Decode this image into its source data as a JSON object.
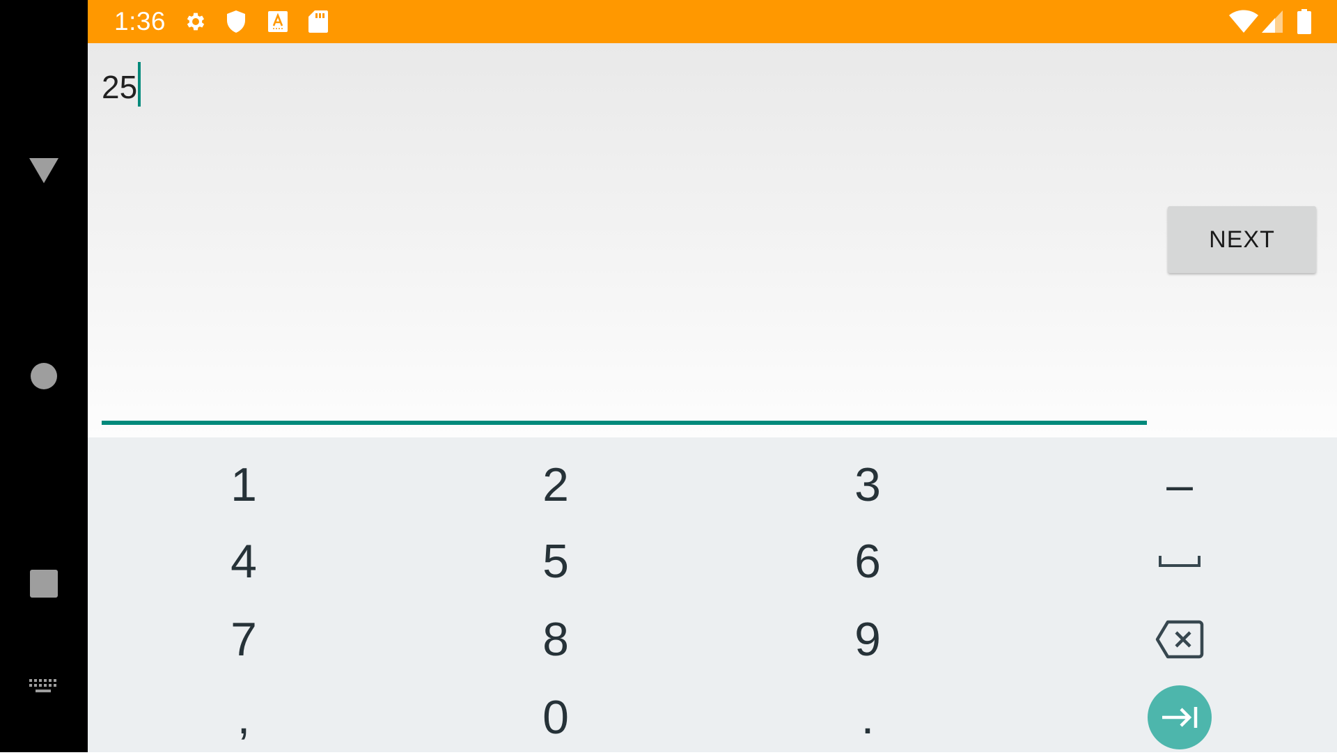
{
  "status_bar": {
    "time": "1:36",
    "icons": [
      "settings-icon",
      "shield-icon",
      "text-a-icon",
      "sd-card-icon",
      "wifi-icon",
      "signal-icon",
      "battery-icon"
    ],
    "background_color": "#ff9800"
  },
  "navigation": {
    "icons": [
      "back-triangle-icon",
      "home-circle-icon",
      "recents-square-icon",
      "keyboard-icon"
    ]
  },
  "input": {
    "value": "25",
    "accent_color": "#00897b"
  },
  "next_button": {
    "label": "NEXT"
  },
  "keyboard": {
    "keys": {
      "k1": "1",
      "k2": "2",
      "k3": "3",
      "dash": "–",
      "k4": "4",
      "k5": "5",
      "k6": "6",
      "k7": "7",
      "k8": "8",
      "k9": "9",
      "comma": ",",
      "k0": "0",
      "period": "."
    },
    "special_keys": [
      "space-icon",
      "backspace-icon",
      "tab-next-icon"
    ],
    "enter_color": "#4db6ac"
  }
}
